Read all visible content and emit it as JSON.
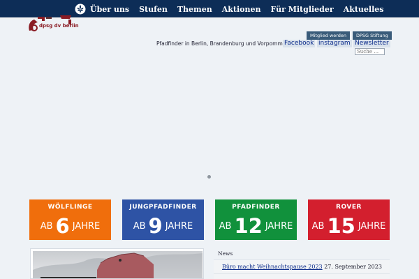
{
  "nav": {
    "items": [
      "Über uns",
      "Stufen",
      "Themen",
      "Aktionen",
      "Für Mitglieder",
      "Aktuelles"
    ]
  },
  "logo": {
    "text": "dpsg dv berlin"
  },
  "header": {
    "buttons": [
      "Mitglied werden",
      "DPSG Stiftung"
    ],
    "tagline": "Pfadfinder in Berlin, Brandenburg und Vorpommern",
    "social": [
      "Facebook",
      "instagram",
      "Newsletter"
    ],
    "search_placeholder": "Suche …"
  },
  "stufen": [
    {
      "title": "WÖLFLINGE",
      "ab": "AB",
      "age": "6",
      "jahre": "JAHRE",
      "color": "#f06e0c"
    },
    {
      "title": "JUNGPFADFINDER",
      "ab": "AB",
      "age": "9",
      "jahre": "JAHRE",
      "color": "#2e53a5"
    },
    {
      "title": "PFADFINDER",
      "ab": "AB",
      "age": "12",
      "jahre": "JAHRE",
      "color": "#11913c"
    },
    {
      "title": "ROVER",
      "ab": "AB",
      "age": "15",
      "jahre": "JAHRE",
      "color": "#d31f2e"
    }
  ],
  "news": {
    "label": "News",
    "items": [
      {
        "title": "Büro macht Weihnachtspause 2023",
        "date": "27. September 2023"
      }
    ]
  },
  "colors": {
    "nav_bg": "#0d2d57",
    "page_bg": "#eef2f6",
    "logo_red": "#8a1c24"
  }
}
